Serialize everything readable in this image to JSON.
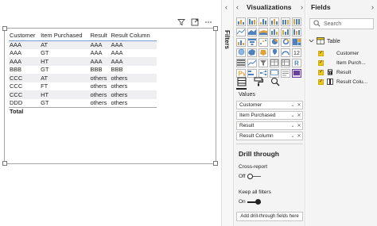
{
  "table": {
    "columns": [
      "Customer",
      "Item Purchased",
      "Result",
      "Result Column"
    ],
    "rows": [
      [
        "AAA",
        "AT",
        "AAA",
        "AAA"
      ],
      [
        "AAA",
        "GT",
        "AAA",
        "AAA"
      ],
      [
        "AAA",
        "HT",
        "AAA",
        "AAA"
      ],
      [
        "BBB",
        "GT",
        "BBB",
        "BBB"
      ],
      [
        "CCC",
        "AT",
        "others",
        "others"
      ],
      [
        "CCC",
        "FT",
        "others",
        "others"
      ],
      [
        "CCC",
        "HT",
        "others",
        "others"
      ],
      [
        "DDD",
        "GT",
        "others",
        "others"
      ]
    ],
    "total_label": "Total"
  },
  "filters": {
    "label": "Filters",
    "chevron": "‹"
  },
  "visualizations": {
    "title": "Visualizations",
    "back": "‹",
    "forward": "›",
    "values_label": "Values",
    "wells": [
      "Customer",
      "Item Purchased",
      "Result",
      "Result Column"
    ],
    "well_chevron": "⌄",
    "well_close": "✕",
    "drill_through": {
      "title": "Drill through",
      "cross_report_label": "Cross-report",
      "cross_report_state": "Off",
      "keep_filters_label": "Keep all filters",
      "keep_filters_state": "On",
      "add_button": "Add drill-through fields here"
    }
  },
  "fields": {
    "title": "Fields",
    "forward": "›",
    "search_placeholder": "Search",
    "table_name": "Table",
    "items": [
      {
        "label": "Customer",
        "icon": "none"
      },
      {
        "label": "Item Purch...",
        "icon": "none"
      },
      {
        "label": "Result",
        "icon": "calculator-icon"
      },
      {
        "label": "Result Colu...",
        "icon": "table-column-icon"
      }
    ],
    "checkmark": "✓"
  },
  "colors": {
    "accent_yellow": "#f2c811",
    "header_underline": "#7a9cd6",
    "selected_visual": "#6b3fa0"
  }
}
